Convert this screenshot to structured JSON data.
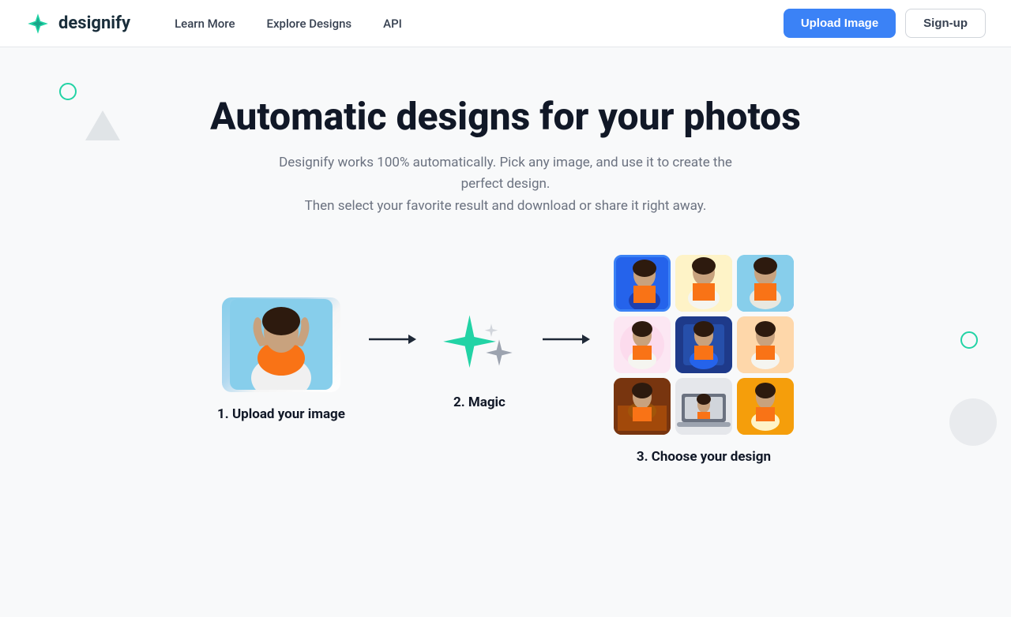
{
  "nav": {
    "logo_text": "designify",
    "links": [
      {
        "label": "Learn More",
        "id": "learn-more"
      },
      {
        "label": "Explore Designs",
        "id": "explore-designs"
      },
      {
        "label": "API",
        "id": "api"
      }
    ],
    "upload_button": "Upload Image",
    "signup_button": "Sign-up"
  },
  "hero": {
    "title": "Automatic designs for your photos",
    "subtitle": "Designify works 100% automatically. Pick any image, and use it to create the perfect design.\nThen select your favorite result and download or share it right away."
  },
  "workflow": {
    "step1_label": "1. Upload your image",
    "step2_label": "2. Magic",
    "step3_label": "3. Choose your design"
  }
}
